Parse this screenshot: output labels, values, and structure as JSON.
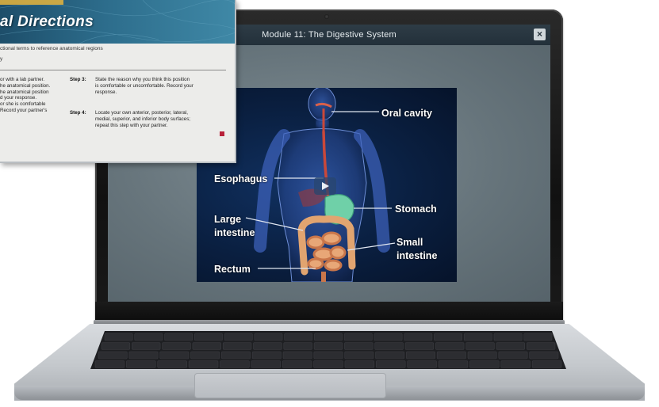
{
  "module": {
    "title": "Module 11: The Digestive System",
    "close_label": "×"
  },
  "video": {
    "labels": {
      "oral_cavity": "Oral cavity",
      "esophagus": "Esophagus",
      "stomach": "Stomach",
      "large_intestine_1": "Large",
      "large_intestine_2": "intestine",
      "small_intestine_1": "Small",
      "small_intestine_2": "intestine",
      "rectum": "Rectum"
    },
    "play_icon": "play-icon"
  },
  "overlay": {
    "banner_title": "al Directions",
    "intro_line1": "ctional terms to reference anatomical regions",
    "intro_line2": "y",
    "left_col": [
      "or with a lab partner.",
      "he anatomical position.",
      "he anatomical position",
      "d your response.",
      "or she is comfortable",
      "Record your partner's"
    ],
    "step3_label": "Step 3:",
    "step3_lines": [
      "State the reason why you think this position",
      "is comfortable or uncomfortable. Record your",
      "response."
    ],
    "step4_label": "Step 4:",
    "step4_lines": [
      "Locate your own anterior, posterior, lateral,",
      "medial, superior, and inferior body surfaces;",
      "repeat this step with your partner."
    ]
  },
  "colors": {
    "screen_header": "#2e3c46",
    "video_bg": "#0a1f40",
    "banner": "#2d6d8c",
    "stop_mark": "#b8213a"
  }
}
